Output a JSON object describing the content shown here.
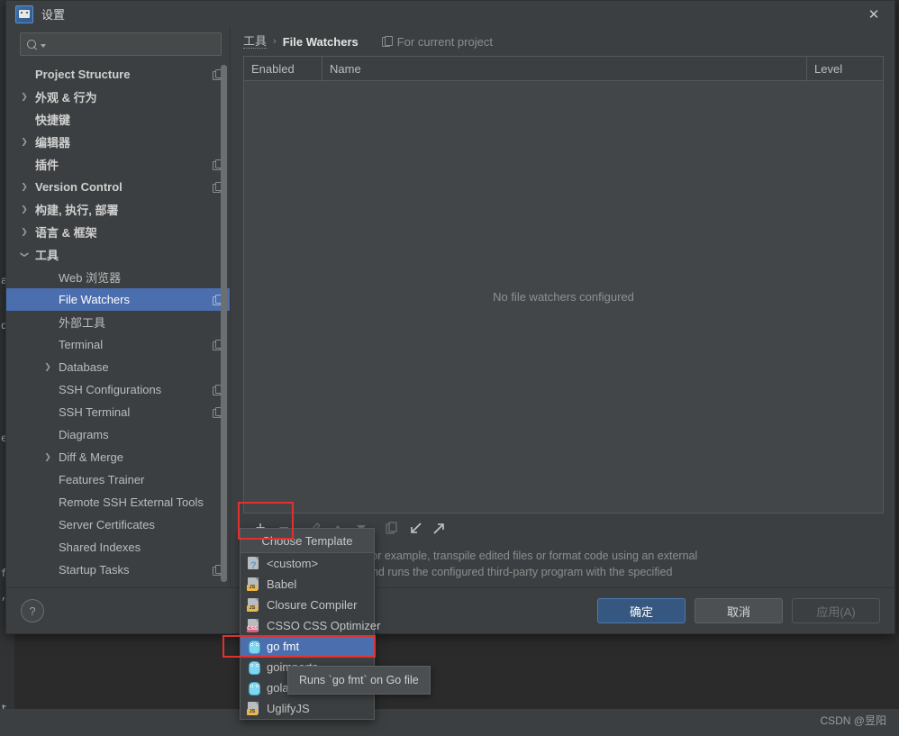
{
  "window": {
    "title": "设置",
    "app_icon": "go-logo-icon",
    "close_label": "✕"
  },
  "sidebar": {
    "search": {
      "placeholder": "",
      "value": "",
      "icon": "search-icon"
    },
    "items": [
      {
        "label": "Project Structure",
        "indent": 0,
        "arrow": "",
        "bold": true,
        "badge": true,
        "selected": false
      },
      {
        "label": "外观 & 行为",
        "indent": 0,
        "arrow": "▶",
        "bold": true,
        "badge": false,
        "selected": false
      },
      {
        "label": "快捷键",
        "indent": 0,
        "arrow": "",
        "bold": true,
        "badge": false,
        "selected": false
      },
      {
        "label": "编辑器",
        "indent": 0,
        "arrow": "▶",
        "bold": true,
        "badge": false,
        "selected": false
      },
      {
        "label": "插件",
        "indent": 0,
        "arrow": "",
        "bold": true,
        "badge": true,
        "selected": false
      },
      {
        "label": "Version Control",
        "indent": 0,
        "arrow": "▶",
        "bold": true,
        "badge": true,
        "selected": false
      },
      {
        "label": "构建, 执行, 部署",
        "indent": 0,
        "arrow": "▶",
        "bold": true,
        "badge": false,
        "selected": false
      },
      {
        "label": "语言 & 框架",
        "indent": 0,
        "arrow": "▶",
        "bold": true,
        "badge": false,
        "selected": false
      },
      {
        "label": "工具",
        "indent": 0,
        "arrow": "▼",
        "bold": true,
        "badge": false,
        "selected": false
      },
      {
        "label": "Web 浏览器",
        "indent": 1,
        "arrow": "",
        "bold": false,
        "badge": false,
        "selected": false
      },
      {
        "label": "File Watchers",
        "indent": 1,
        "arrow": "",
        "bold": false,
        "badge": true,
        "selected": true
      },
      {
        "label": "外部工具",
        "indent": 1,
        "arrow": "",
        "bold": false,
        "badge": false,
        "selected": false
      },
      {
        "label": "Terminal",
        "indent": 1,
        "arrow": "",
        "bold": false,
        "badge": true,
        "selected": false
      },
      {
        "label": "Database",
        "indent": 1,
        "arrow": "▶",
        "bold": false,
        "badge": false,
        "selected": false
      },
      {
        "label": "SSH Configurations",
        "indent": 1,
        "arrow": "",
        "bold": false,
        "badge": true,
        "selected": false
      },
      {
        "label": "SSH Terminal",
        "indent": 1,
        "arrow": "",
        "bold": false,
        "badge": true,
        "selected": false
      },
      {
        "label": "Diagrams",
        "indent": 1,
        "arrow": "",
        "bold": false,
        "badge": false,
        "selected": false
      },
      {
        "label": "Diff & Merge",
        "indent": 1,
        "arrow": "▶",
        "bold": false,
        "badge": false,
        "selected": false
      },
      {
        "label": "Features Trainer",
        "indent": 1,
        "arrow": "",
        "bold": false,
        "badge": false,
        "selected": false
      },
      {
        "label": "Remote SSH External Tools",
        "indent": 1,
        "arrow": "",
        "bold": false,
        "badge": false,
        "selected": false
      },
      {
        "label": "Server Certificates",
        "indent": 1,
        "arrow": "",
        "bold": false,
        "badge": false,
        "selected": false
      },
      {
        "label": "Shared Indexes",
        "indent": 1,
        "arrow": "",
        "bold": false,
        "badge": false,
        "selected": false
      },
      {
        "label": "Startup Tasks",
        "indent": 1,
        "arrow": "",
        "bold": false,
        "badge": true,
        "selected": false
      }
    ]
  },
  "main": {
    "breadcrumb": {
      "root": "工具",
      "separator": "›",
      "leaf": "File Watchers"
    },
    "scope": {
      "label": "For current project",
      "icon": "copy-scope-icon"
    },
    "table": {
      "columns": [
        "Enabled",
        "Name",
        "Level"
      ],
      "rows": [],
      "empty_text": "No file watchers configured"
    },
    "toolbar": [
      {
        "name": "add-button",
        "glyph": "+",
        "enabled": true
      },
      {
        "name": "remove-button",
        "glyph": "−",
        "enabled": false
      },
      {
        "name": "edit-button",
        "glyph": "✎",
        "enabled": false
      },
      {
        "name": "move-up-button",
        "glyph": "▲",
        "enabled": false
      },
      {
        "name": "move-down-button",
        "glyph": "▼",
        "enabled": false
      },
      {
        "name": "copy-button",
        "glyph": "⧉",
        "enabled": false
      },
      {
        "name": "import-button",
        "glyph": "↙",
        "enabled": true
      },
      {
        "name": "export-button",
        "glyph": "↗",
        "enabled": true
      }
    ],
    "description_line1": "certain actions on save, for example, transpile edited files or format code using an external",
    "description_line2": "nges to the project files and runs the configured third-party program with the specified"
  },
  "popup": {
    "title": "Choose Template",
    "items": [
      {
        "label": "<custom>",
        "icon": "custom-file-icon",
        "selected": false
      },
      {
        "label": "Babel",
        "icon": "js-file-icon",
        "selected": false
      },
      {
        "label": "Closure Compiler",
        "icon": "js-file-icon",
        "selected": false
      },
      {
        "label": "CSSO CSS Optimizer",
        "icon": "css-file-icon",
        "selected": false
      },
      {
        "label": "go fmt",
        "icon": "go-gopher-icon",
        "selected": true
      },
      {
        "label": "goimports",
        "icon": "go-gopher-icon",
        "selected": false
      },
      {
        "label": "golangci-lint",
        "icon": "go-gopher-icon",
        "selected": false
      },
      {
        "label": "UglifyJS",
        "icon": "js-file-icon",
        "selected": false
      }
    ]
  },
  "tooltip": {
    "text": "Runs `go fmt` on Go file"
  },
  "footer": {
    "help_glyph": "?",
    "ok_label": "确定",
    "cancel_label": "取消",
    "apply_label": "应用(A)"
  },
  "watermark": {
    "text": "CSDN @昱阳"
  },
  "background": {
    "gutter_lines": [
      "a",
      "d",
      "e",
      "f",
      ",",
      "t"
    ]
  },
  "colors": {
    "accent": "#4b6eaf",
    "primary_button": "#365880",
    "annotation": "#e03030",
    "panel": "#3c3f41",
    "table_body": "#434649"
  }
}
